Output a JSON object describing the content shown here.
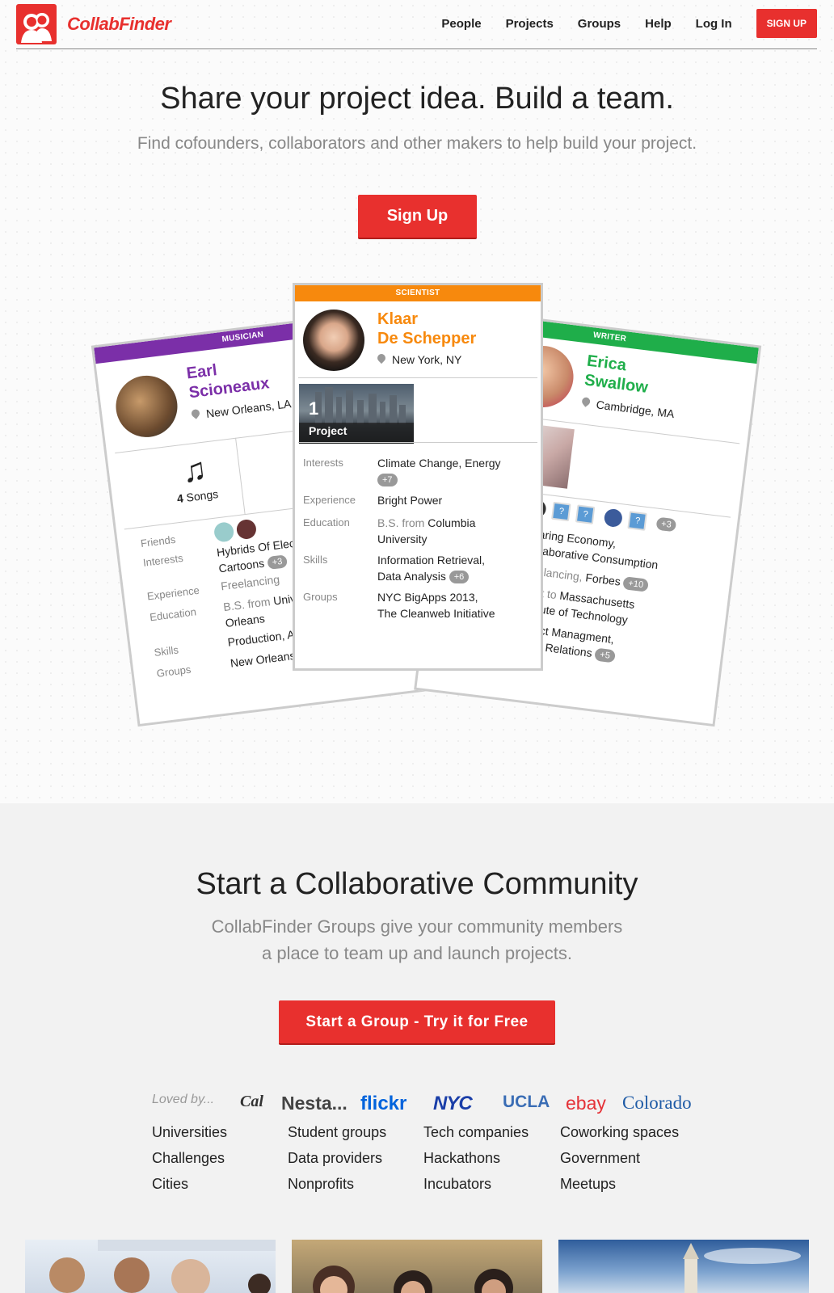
{
  "header": {
    "logo_text": "CollabFinder",
    "nav": [
      "People",
      "Projects",
      "Groups",
      "Help",
      "Log In"
    ],
    "signup_label": "SIGN UP"
  },
  "hero": {
    "title": "Share your project idea. Build a team.",
    "subtitle": "Find cofounders, collaborators and other makers to help build your project.",
    "button": "Sign Up"
  },
  "cards": {
    "musician": {
      "role": "MUSICIAN",
      "first": "Earl",
      "last": "Scioneaux",
      "location": "New Orleans, LA",
      "songs_count": "4",
      "songs_label": "Songs",
      "labels": [
        "Friends",
        "Interests",
        "Experience",
        "Education",
        "Skills",
        "Groups"
      ],
      "interests": "Hybrids Of Electro",
      "interests2": "Cartoons",
      "interests_more": "+3",
      "experience": "Freelancing",
      "education_prefix": "B.S. from",
      "education": "Univer",
      "education2": "Orleans",
      "skills": "Production, Arra",
      "groups": "New Orleans M"
    },
    "scientist": {
      "role": "SCIENTIST",
      "first": "Klaar",
      "last": "De Schepper",
      "location": "New York, NY",
      "project_count": "1",
      "project_label": "Project",
      "labels": [
        "Interests",
        "Experience",
        "Education",
        "Skills",
        "Groups"
      ],
      "interests": "Climate Change, Energy",
      "interests_more": "+7",
      "experience": "Bright Power",
      "education_prefix": "B.S. from",
      "education": "Columbia",
      "education2": "University",
      "skills": "Information Retrieval,",
      "skills2": "Data Analysis",
      "skills_more": "+6",
      "groups": "NYC BigApps 2013,",
      "groups2": "The Cleanweb Initiative"
    },
    "writer": {
      "role": "WRITER",
      "first": "Erica",
      "last": "Swallow",
      "location": "Cambridge, MA",
      "friends_more": "+3",
      "interests": "Sharing Economy,",
      "interests2": "Collaborative Consumption",
      "experience_prefix": "Freelancing,",
      "experience": "Forbes",
      "experience_more": "+10",
      "education_prefix": "Went to",
      "education": "Massachusetts",
      "education2": "Institute of Technology",
      "skills": "Project Managment,",
      "skills2": "Public Relations",
      "skills_more": "+5"
    }
  },
  "community": {
    "title": "Start a Collaborative Community",
    "subtitle_line1": "CollabFinder Groups give your community members",
    "subtitle_line2": "a place to team up and launch projects.",
    "button": "Start a Group - Try it for Free",
    "loved_by": "Loved by...",
    "brands": [
      "Cal",
      "Nesta...",
      "flickr",
      "NYC",
      "UCLA",
      "ebay",
      "Colorado"
    ],
    "categories": [
      [
        "Universities",
        "Challenges",
        "Cities"
      ],
      [
        "Student groups",
        "Data providers",
        "Nonprofits"
      ],
      [
        "Tech companies",
        "Hackathons",
        "Incubators"
      ],
      [
        "Coworking spaces",
        "Government",
        "Meetups"
      ]
    ]
  },
  "colors": {
    "brand_red": "#e8302e",
    "musician": "#7b2fa8",
    "scientist": "#f7890d",
    "writer": "#1fae4a"
  }
}
